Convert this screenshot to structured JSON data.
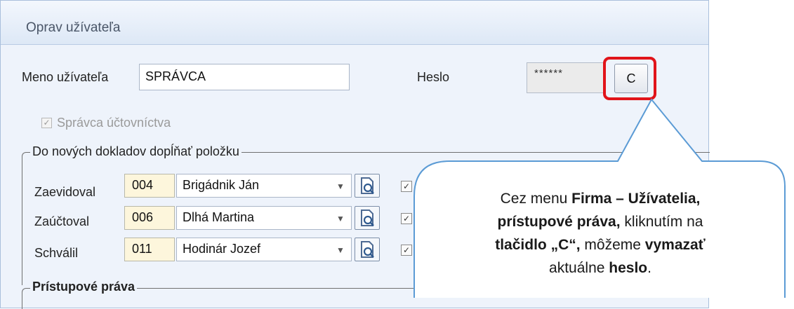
{
  "dialog": {
    "title": "Oprav užívateľa",
    "username_label": "Meno užívateľa",
    "username_value": "SPRÁVCA",
    "password_label": "Heslo",
    "password_value": "******",
    "clear_button_label": "C",
    "admin_checkbox_label": "Správca účtovníctva",
    "admin_checked": true,
    "group_documents_title": "Do nových dokladov dopĺňať položku",
    "rows": [
      {
        "label": "Zaevidoval",
        "code": "004",
        "name": "Brigádnik Ján"
      },
      {
        "label": "Zaúčtoval",
        "code": "006",
        "name": "Dlhá Martina"
      },
      {
        "label": "Schválil",
        "code": "011",
        "name": "Hodinár Jozef"
      }
    ],
    "group_access_title": "Prístupové práva"
  },
  "callout": {
    "line1_a": "Cez menu ",
    "line1_b": "Firma – Užívatelia,",
    "line2_a": "prístupové práva,",
    "line2_b": " kliknutím na",
    "line3_a": "tlačidlo „C“,",
    "line3_b": " môžeme ",
    "line3_c": "vymazať",
    "line4_a": "aktuálne ",
    "line4_b": "heslo",
    "line4_c": "."
  },
  "colors": {
    "highlight": "#e1141a",
    "callout_border": "#5b9bd5",
    "code_background": "#fdf6dc"
  }
}
